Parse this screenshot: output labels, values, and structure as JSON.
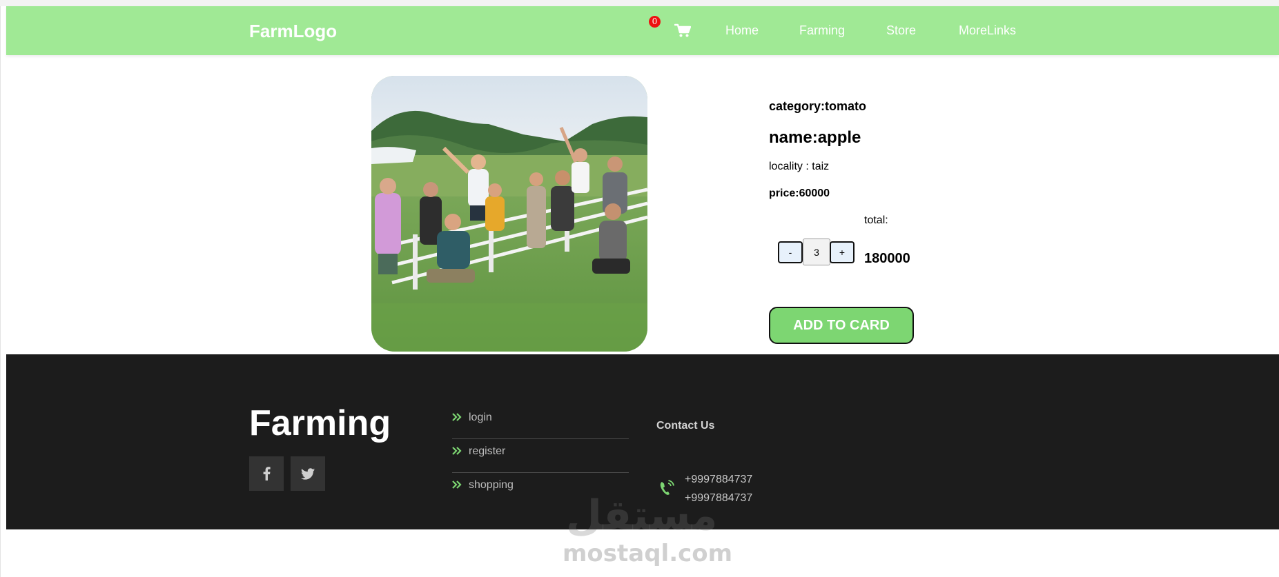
{
  "navbar": {
    "logo": "FarmLogo",
    "cart_count": "0",
    "links": [
      "Home",
      "Farming",
      "Store",
      "MoreLinks"
    ]
  },
  "product": {
    "category": "category:tomato",
    "name": "name:apple",
    "locality": "locality : taiz",
    "price": "price:60000",
    "total_label": "total:",
    "quantity": "3",
    "minus": "-",
    "plus": "+",
    "total_value": "180000",
    "add_button": "ADD TO CARD"
  },
  "footer": {
    "title": "Farming",
    "social": [
      "facebook-icon",
      "twitter-icon"
    ],
    "links": [
      "login",
      "register",
      "shopping"
    ],
    "contact_title": "Contact Us",
    "phones": [
      "+9997884737",
      "+9997884737"
    ]
  },
  "watermark": {
    "arabic": "مستقل",
    "latin": "mostaql.com"
  },
  "colors": {
    "navbar_bg": "#a0e995",
    "add_button_bg": "#7dd672",
    "footer_bg": "#1c1c1c",
    "accent_green": "#7dd672",
    "badge_red": "#ee1111"
  }
}
